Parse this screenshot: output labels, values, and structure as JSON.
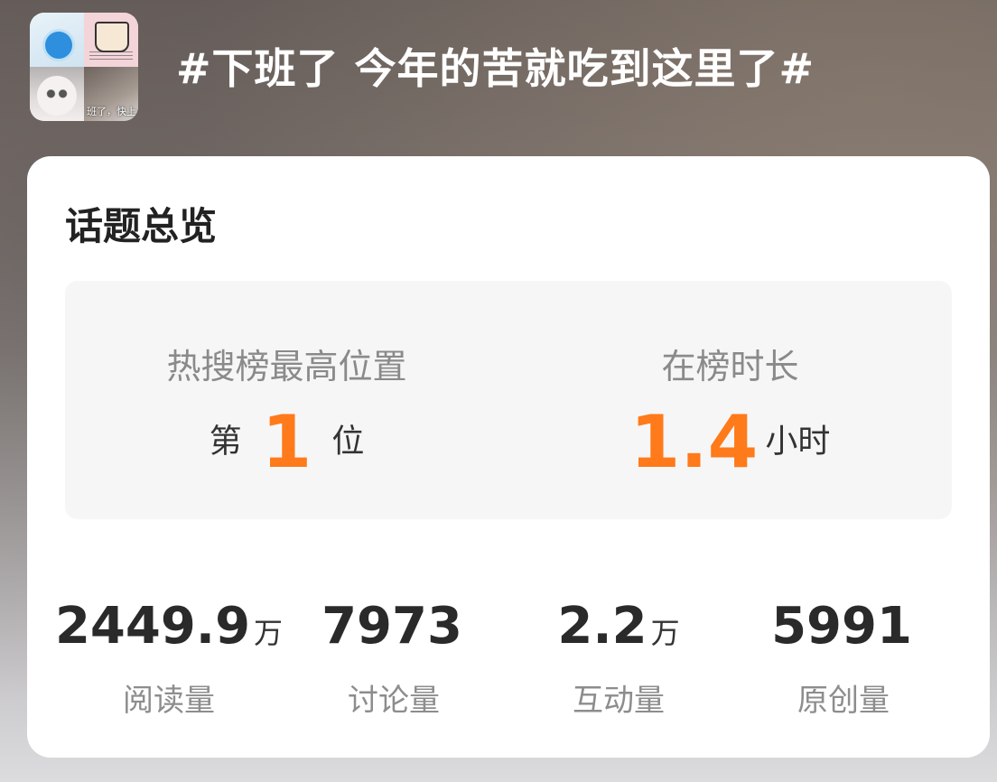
{
  "header": {
    "topic_title": "#下班了 今年的苦就吃到这里了#",
    "thumbnail_caption": "班了，快上"
  },
  "overview": {
    "title": "话题总览",
    "rank": {
      "label": "热搜榜最高位置",
      "prefix": "第",
      "value": "1",
      "suffix": "位"
    },
    "duration": {
      "label": "在榜时长",
      "value": "1.4",
      "unit": "小时"
    },
    "stats": [
      {
        "value": "2449.9",
        "unit": "万",
        "label": "阅读量"
      },
      {
        "value": "7973",
        "unit": "",
        "label": "讨论量"
      },
      {
        "value": "2.2",
        "unit": "万",
        "label": "互动量"
      },
      {
        "value": "5991",
        "unit": "",
        "label": "原创量"
      }
    ]
  },
  "colors": {
    "accent": "#ff7a1a",
    "card_background": "#ffffff",
    "rank_box_background": "#f6f6f6"
  }
}
